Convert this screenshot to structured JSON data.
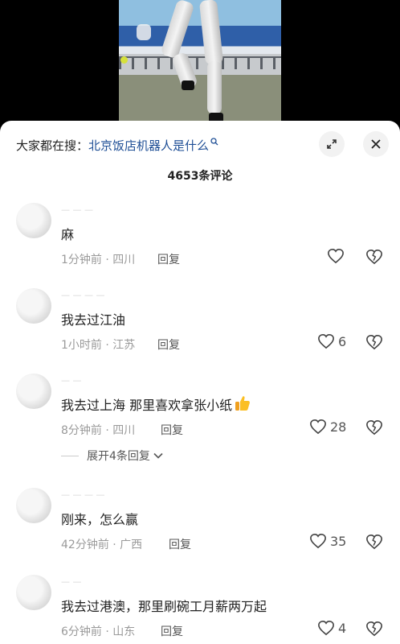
{
  "search": {
    "prefix": "大家都在搜：",
    "term": "北京饭店机器人是什么"
  },
  "comment_count": "4653条评论",
  "comments": [
    {
      "text": "麻",
      "meta": "1分钟前 · 四川",
      "reply_label": "回复",
      "likes": ""
    },
    {
      "text": "我去过江油",
      "meta": "1小时前 · 江苏",
      "reply_label": "回复",
      "likes": "6"
    },
    {
      "text": "我去过上海 那里喜欢拿张小纸",
      "meta": "8分钟前 · 四川",
      "reply_label": "回复",
      "likes": "28",
      "expand_label": "展开4条回复"
    },
    {
      "text": "刚来，怎么赢",
      "meta": "42分钟前 · 广西",
      "reply_label": "回复",
      "likes": "35"
    },
    {
      "text": "我去过港澳，那里刷碗工月薪两万起",
      "meta": "6分钟前 · 山东",
      "reply_label": "回复",
      "likes": "4"
    }
  ],
  "icons": {
    "expand": "expand-icon",
    "close": "close-icon",
    "like": "heart-icon",
    "dislike": "broken-heart-icon",
    "thumb": "thumbs-up-emoji"
  },
  "colors": {
    "search_term": "#1f4f96",
    "meta": "#9a9a9a",
    "sheet": "#ffffff"
  }
}
